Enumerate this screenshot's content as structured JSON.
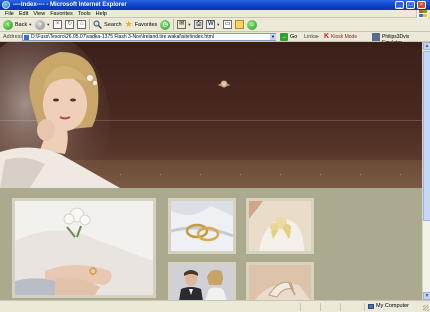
{
  "window": {
    "title": "----Index---- - Microsoft Internet Explorer",
    "controls": [
      "minimize",
      "maximize",
      "close"
    ]
  },
  "menu": {
    "items": [
      "File",
      "Edit",
      "View",
      "Favorites",
      "Tools",
      "Help"
    ]
  },
  "toolbar": {
    "back_label": "Back",
    "search_label": "Search",
    "favorites_label": "Favorites"
  },
  "address": {
    "label": "Address",
    "value": "D:\\Fuss\\Tesoro\\26.05.07\\vadka-1375 Flash 3-Nov\\Ireland.tire.wakal\\site\\index.html",
    "go_label": "Go",
    "links_label": "Links",
    "kiosk_label": "Kiosk Mode",
    "emulator_label": "Philips3Dvix Emulator"
  },
  "status": {
    "zone": "My Computer"
  },
  "icons": {
    "back": "back-arrow-icon",
    "forward": "forward-arrow-icon",
    "stop": "stop-icon",
    "refresh": "refresh-icon",
    "home": "home-icon",
    "search": "search-icon",
    "favorites": "favorites-star-icon",
    "history": "history-icon",
    "mail": "mail-icon",
    "print": "print-icon",
    "edit": "edit-icon",
    "folder": "folder-icon",
    "messenger": "messenger-icon"
  },
  "colors": {
    "hero_dark": "#3a1f19",
    "hero_floor": "#6d4c38",
    "panel_bg": "#aba98e",
    "photo_frame": "#d5d3c0",
    "title_bar": "#0a3fc7"
  }
}
